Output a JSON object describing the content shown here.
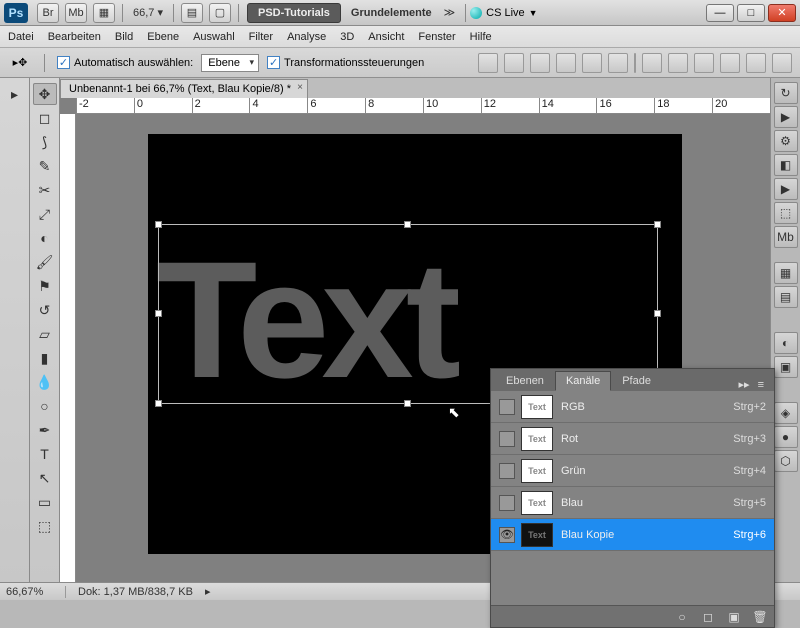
{
  "titlebar": {
    "app": "Ps",
    "zoom_pct": "66,7",
    "workspace_btn": "PSD-Tutorials",
    "workspace_alt": "Grundelemente",
    "cslive": "CS Live"
  },
  "menu": {
    "items": [
      "Datei",
      "Bearbeiten",
      "Bild",
      "Ebene",
      "Auswahl",
      "Filter",
      "Analyse",
      "3D",
      "Ansicht",
      "Fenster",
      "Hilfe"
    ]
  },
  "optbar": {
    "auto_select_label": "Automatisch auswählen:",
    "auto_select_value": "Ebene",
    "transform_ctrl_label": "Transformationssteuerungen"
  },
  "doc": {
    "tab_title": "Unbenannt-1 bei 66,7% (Text, Blau Kopie/8) *",
    "canvas_text": "Text",
    "ruler_marks": [
      "-2",
      "0",
      "2",
      "4",
      "6",
      "8",
      "10",
      "12",
      "14",
      "16",
      "18",
      "20"
    ]
  },
  "panel": {
    "tabs": [
      "Ebenen",
      "Kanäle",
      "Pfade"
    ],
    "active_tab_index": 1,
    "channels": [
      {
        "name": "RGB",
        "shortcut": "Strg+2",
        "selected": false,
        "visible": false,
        "dark": false
      },
      {
        "name": "Rot",
        "shortcut": "Strg+3",
        "selected": false,
        "visible": false,
        "dark": false
      },
      {
        "name": "Grün",
        "shortcut": "Strg+4",
        "selected": false,
        "visible": false,
        "dark": false
      },
      {
        "name": "Blau",
        "shortcut": "Strg+5",
        "selected": false,
        "visible": false,
        "dark": false
      },
      {
        "name": "Blau Kopie",
        "shortcut": "Strg+6",
        "selected": true,
        "visible": true,
        "dark": true
      }
    ],
    "thumb_text": "Text"
  },
  "status": {
    "zoom": "66,67%",
    "docinfo": "Dok: 1,37 MB/838,7 KB"
  },
  "icons": {
    "br": "Br",
    "mb": "Mb"
  }
}
